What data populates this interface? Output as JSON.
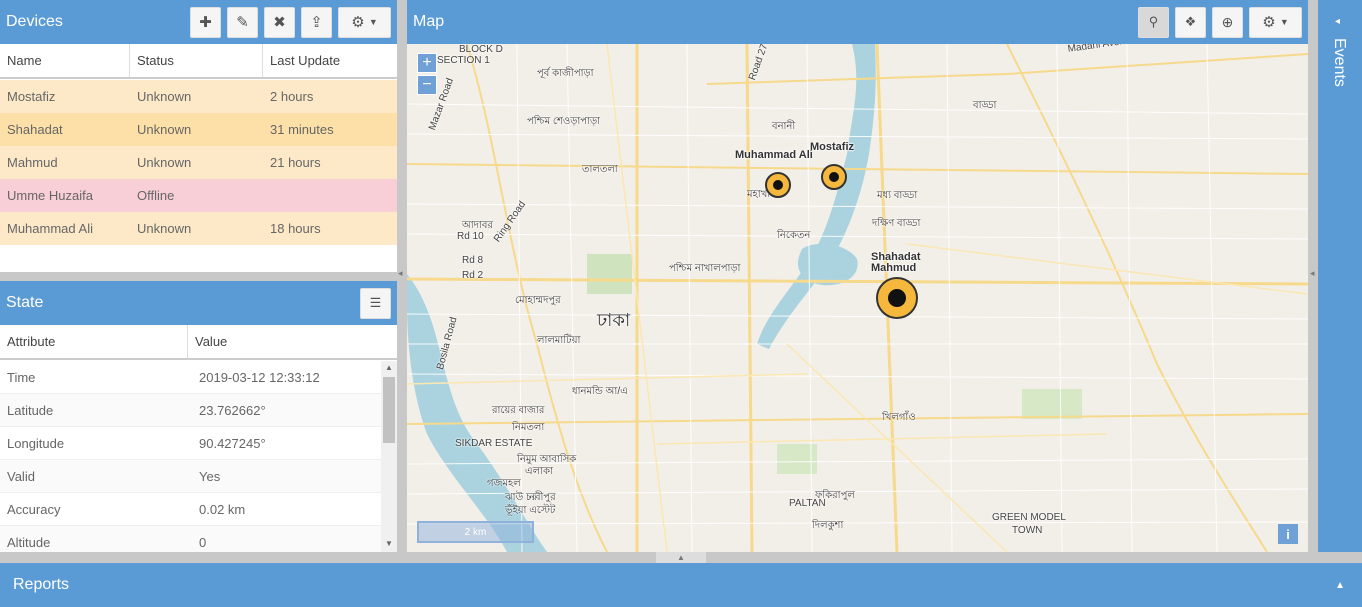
{
  "devices": {
    "title": "Devices",
    "columns": [
      "Name",
      "Status",
      "Last Update"
    ],
    "rows": [
      {
        "name": "Mostafiz",
        "status": "Unknown",
        "last_update": "2 hours",
        "color": "#fde9c8"
      },
      {
        "name": "Shahadat",
        "status": "Unknown",
        "last_update": "31 minutes",
        "color": "#fde0a8"
      },
      {
        "name": "Mahmud",
        "status": "Unknown",
        "last_update": "21 hours",
        "color": "#fde9c8"
      },
      {
        "name": "Umme Huzaifa",
        "status": "Offline",
        "last_update": "",
        "color": "#f8cfd6"
      },
      {
        "name": "Muhammad Ali",
        "status": "Unknown",
        "last_update": "18 hours",
        "color": "#fde9c8"
      }
    ]
  },
  "state": {
    "title": "State",
    "columns": [
      "Attribute",
      "Value"
    ],
    "rows": [
      {
        "attribute": "Time",
        "value": "2019-03-12 12:33:12"
      },
      {
        "attribute": "Latitude",
        "value": "23.762662°"
      },
      {
        "attribute": "Longitude",
        "value": "90.427245°"
      },
      {
        "attribute": "Valid",
        "value": "Yes"
      },
      {
        "attribute": "Accuracy",
        "value": "0.02 km"
      },
      {
        "attribute": "Altitude",
        "value": "0"
      }
    ]
  },
  "map": {
    "title": "Map",
    "scale_label": "2 km",
    "zoom_in": "+",
    "zoom_out": "−",
    "info": "i",
    "city_label": "ঢাকা",
    "labels": [
      "BLOCK D",
      "SECTION 1",
      "পূর্ব কাজীপাড়া",
      "Madani Avenue",
      "Road 27",
      "পশ্চিম শেওড়াপাড়া",
      "বনানী",
      "বাড্ডা",
      "তালতলা",
      "Mazar Road",
      "মধ্য বাড্ডা",
      "দক্ষিণ বাড্ডা",
      "মহাখালী",
      "আদাবর",
      "Rd 10",
      "Rd 8",
      "Rd 2",
      "Ring Road",
      "নিকেতন",
      "পশ্চিম নাখালপাড়া",
      "মোহাম্মদপুর",
      "লালমাটিয়া",
      "ধানমন্ডি আ/এ",
      "রায়ের বাজার",
      "নিমতলা",
      "SIKDAR ESTATE",
      "নিমুম আবাসিক",
      "এলাকা",
      "গজমহল",
      "ঝাউ চর",
      "নবীপুর",
      "ভূঁইয়া এস্টেট",
      "খিলগাঁও",
      "ফকিরাপুল",
      "PALTAN",
      "দিলকুশা",
      "GREEN MODEL",
      "TOWN",
      "Bosila Road"
    ],
    "markers": [
      {
        "name": "Muhammad Ali"
      },
      {
        "name": "Mostafiz"
      },
      {
        "name": "Shahadat"
      },
      {
        "name": "Mahmud"
      }
    ]
  },
  "events": {
    "title": "Events"
  },
  "reports": {
    "title": "Reports"
  },
  "colors": {
    "accent": "#5b9bd5",
    "marker": "#f5b83d",
    "map_bg": "#f2efe9"
  }
}
